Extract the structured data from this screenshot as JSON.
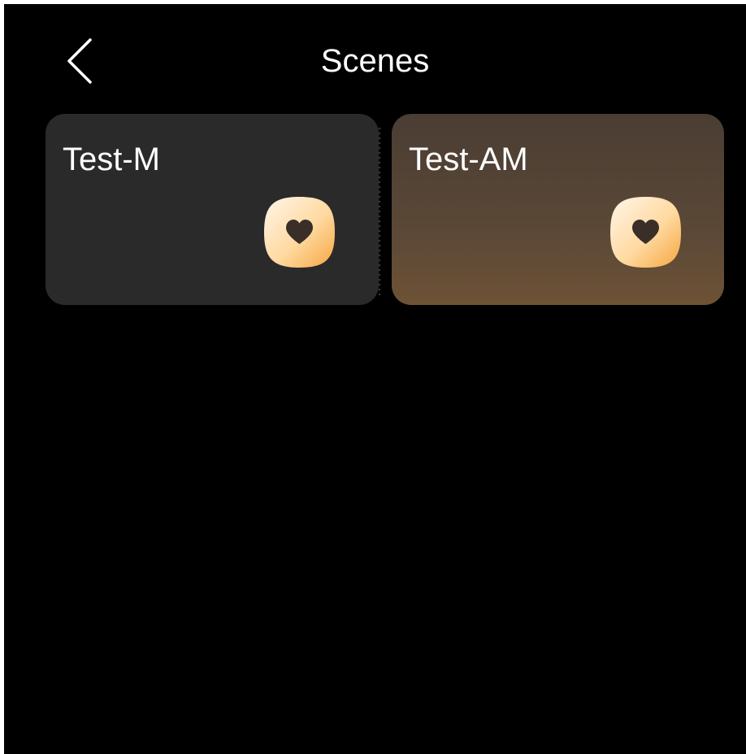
{
  "header": {
    "back_icon": "chevron-left-icon",
    "title": "Scenes"
  },
  "scenes": [
    {
      "name": "Test-M",
      "icon": "heart-icon",
      "background": "#2a2a2a"
    },
    {
      "name": "Test-AM",
      "icon": "heart-icon",
      "background": "#5c4937"
    }
  ],
  "colors": {
    "background": "#000000",
    "text": "#ffffff",
    "icon_gradient_start": "#fff4e6",
    "icon_gradient_end": "#f5a640",
    "heart": "#3a2f28"
  }
}
